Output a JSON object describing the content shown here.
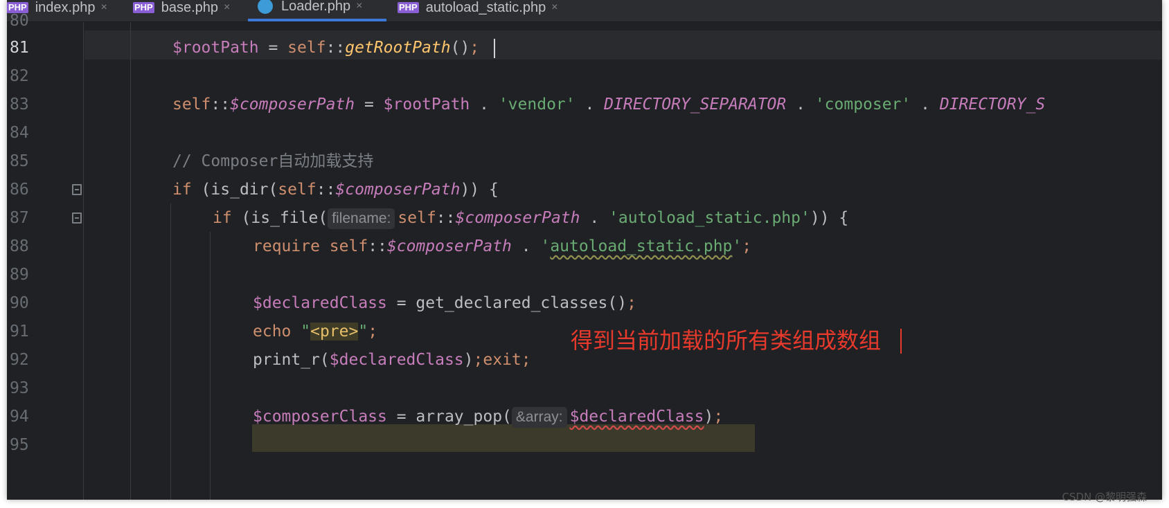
{
  "tabs": [
    {
      "label": "index.php",
      "icon": "php-file-icon",
      "active": false
    },
    {
      "label": "base.php",
      "icon": "php-file-icon",
      "active": false
    },
    {
      "label": "Loader.php",
      "icon": "class-file-icon",
      "active": true
    },
    {
      "label": "autoload_static.php",
      "icon": "php-file-icon",
      "active": false
    }
  ],
  "tab_icon_text": "PHP",
  "close_glyph": "×",
  "line_numbers": [
    "80",
    "81",
    "82",
    "83",
    "84",
    "85",
    "86",
    "87",
    "88",
    "89",
    "90",
    "91",
    "92",
    "93",
    "94",
    "95"
  ],
  "current_line": "81",
  "code": {
    "l81": {
      "v": "$rootPath",
      "eq": " = ",
      "self": "self",
      "sep": "::",
      "fn": "getRootPath",
      "rest": "()",
      "semi": ";"
    },
    "l83": {
      "self": "self",
      "sep": "::",
      "v": "$composerPath",
      "eq": " = ",
      "v2": "$rootPath",
      "dot": " . ",
      "s1": "'vendor'",
      "c1": "DIRECTORY_SEPARATOR",
      "s2": "'composer'",
      "c2": "DIRECTORY_S"
    },
    "l85": {
      "comment": "// Composer自动加载支持"
    },
    "l86": {
      "kw": "if",
      "p1": " (is_dir(",
      "self": "self",
      "sep": "::",
      "v": "$composerPath",
      "p2": ")) {"
    },
    "l87": {
      "kw": "if",
      "p1": " (is_file(",
      "hint": "filename:",
      "self": "self",
      "sep": "::",
      "v": "$composerPath",
      "dot": " . ",
      "s1": "'autoload_static.php'",
      "p2": ")) {"
    },
    "l88": {
      "kw": "require",
      "self": "self",
      "sep": "::",
      "v": "$composerPath",
      "dot": " . ",
      "q1": "'",
      "s1": "autoload_static.php",
      "q2": "'",
      "semi": ";"
    },
    "l90": {
      "v": "$declaredClass",
      "eq": " = ",
      "fn": "get_declared_classes()",
      "semi": ";"
    },
    "l91": {
      "kw": "echo",
      "q1": " \"",
      "tag": "<pre>",
      "q2": "\"",
      "semi": ";"
    },
    "l92": {
      "fn": "print_r(",
      "v": "$declaredClass",
      "p": ")",
      "semi": ";",
      "kw": "exit",
      "semi2": ";"
    },
    "l94": {
      "v": "$composerClass",
      "eq": " = ",
      "fn": "array_pop(",
      "hint": "&array:",
      "v2": "$declaredClass",
      "p": ")",
      "semi": ";"
    }
  },
  "annotation": "得到当前加载的所有类组成数组",
  "watermark": "CSDN @黎明强森",
  "colors": {
    "background": "#1f2124",
    "keyword": "#cf8e6d",
    "variable": "#c77dbb",
    "function": "#ffc66d",
    "string": "#6aab73",
    "comment": "#7a7e85",
    "annotation": "#e83a2c"
  }
}
